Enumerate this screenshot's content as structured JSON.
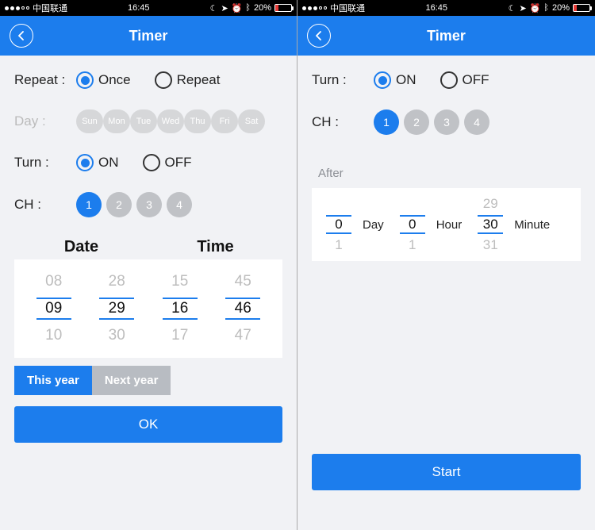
{
  "status": {
    "carrier": "中国联通",
    "time": "16:45",
    "battery_pct": "20%"
  },
  "left": {
    "title": "Timer",
    "repeat": {
      "label": "Repeat :",
      "options": [
        "Once",
        "Repeat"
      ],
      "selected": "Once"
    },
    "day": {
      "label": "Day :",
      "chips": [
        "Sun",
        "Mon",
        "Tue",
        "Wed",
        "Thu",
        "Fri",
        "Sat"
      ]
    },
    "turn": {
      "label": "Turn :",
      "options": [
        "ON",
        "OFF"
      ],
      "selected": "ON"
    },
    "ch": {
      "label": "CH  :",
      "values": [
        "1",
        "2",
        "3",
        "4"
      ],
      "selected": "1"
    },
    "picker": {
      "date_label": "Date",
      "time_label": "Time",
      "month": {
        "prev": "08",
        "sel": "09",
        "next": "10"
      },
      "day": {
        "prev": "28",
        "sel": "29",
        "next": "30"
      },
      "hour": {
        "prev": "15",
        "sel": "16",
        "next": "17"
      },
      "min": {
        "prev": "45",
        "sel": "46",
        "next": "47"
      }
    },
    "year_tabs": {
      "this": "This year",
      "next": "Next year",
      "active": "this"
    },
    "ok_label": "OK"
  },
  "right": {
    "title": "Timer",
    "turn": {
      "label": "Turn :",
      "options": [
        "ON",
        "OFF"
      ],
      "selected": "ON"
    },
    "ch": {
      "label": "CH  :",
      "values": [
        "1",
        "2",
        "3",
        "4"
      ],
      "selected": "1"
    },
    "after_label": "After",
    "duration": {
      "day": {
        "prev": "",
        "sel": "0",
        "next": "1",
        "unit": "Day"
      },
      "hour": {
        "prev": "",
        "sel": "0",
        "next": "1",
        "unit": "Hour"
      },
      "minute": {
        "prev": "29",
        "sel": "30",
        "next": "31",
        "unit": "Minute"
      }
    },
    "start_label": "Start"
  }
}
